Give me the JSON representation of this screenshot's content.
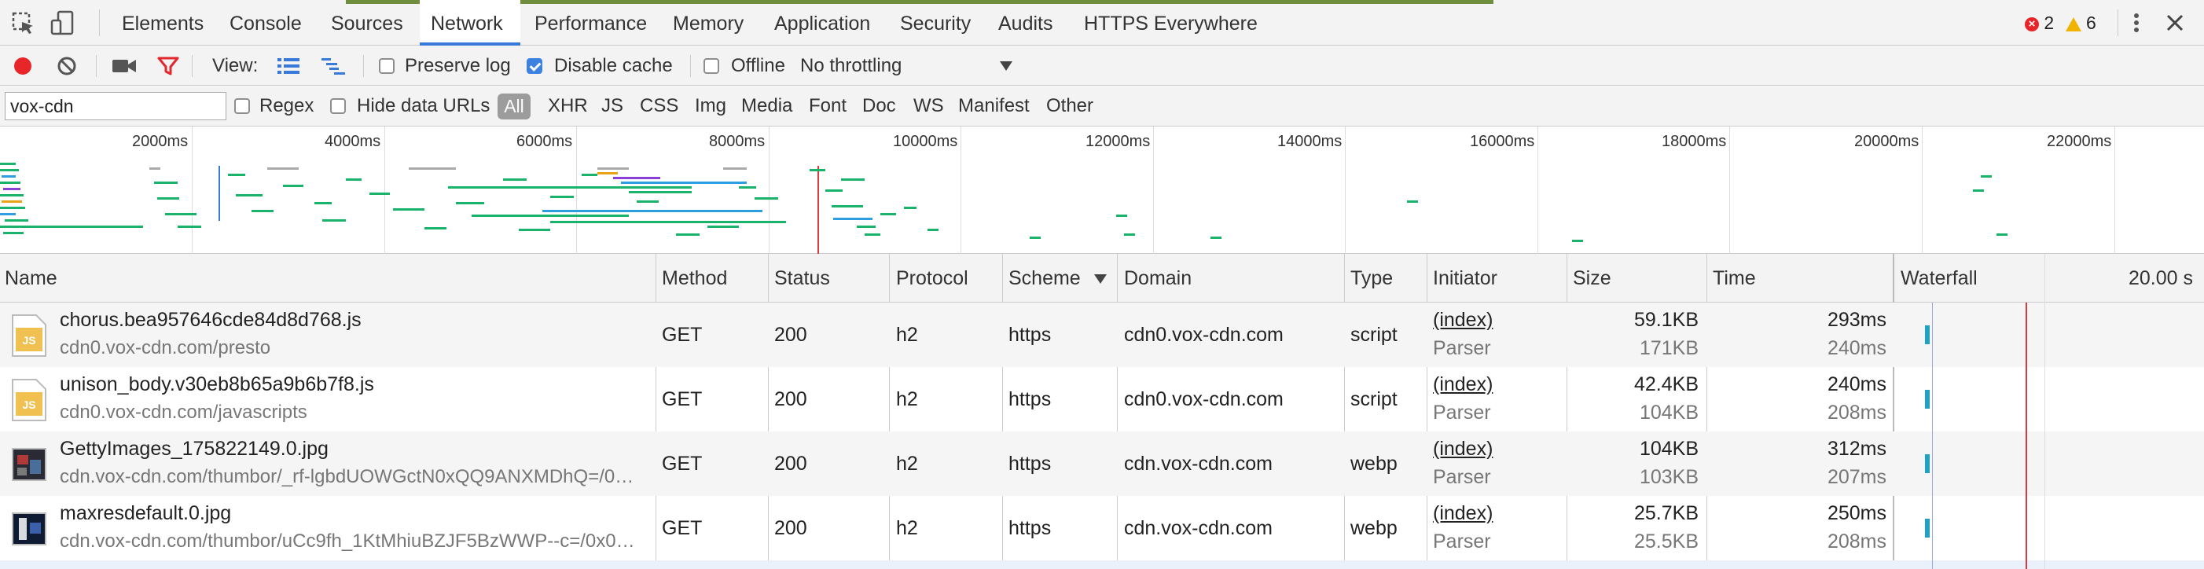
{
  "tabs": [
    {
      "label": "Elements",
      "active": false
    },
    {
      "label": "Console",
      "active": false
    },
    {
      "label": "Sources",
      "active": false
    },
    {
      "label": "Network",
      "active": true
    },
    {
      "label": "Performance",
      "active": false
    },
    {
      "label": "Memory",
      "active": false
    },
    {
      "label": "Application",
      "active": false
    },
    {
      "label": "Security",
      "active": false
    },
    {
      "label": "Audits",
      "active": false
    },
    {
      "label": "HTTPS Everywhere",
      "active": false
    }
  ],
  "status": {
    "errors": "2",
    "warnings": "6"
  },
  "toolbar": {
    "view_label": "View:",
    "preserve_log": {
      "label": "Preserve log",
      "checked": false
    },
    "disable_cache": {
      "label": "Disable cache",
      "checked": true
    },
    "offline": {
      "label": "Offline",
      "checked": false
    },
    "throttling": "No throttling"
  },
  "filter": {
    "value": "vox-cdn",
    "regex_label": "Regex",
    "hide_data_urls_label": "Hide data URLs",
    "types": [
      "All",
      "XHR",
      "JS",
      "CSS",
      "Img",
      "Media",
      "Font",
      "Doc",
      "WS",
      "Manifest",
      "Other"
    ]
  },
  "overview": {
    "ticks": [
      "2000ms",
      "4000ms",
      "6000ms",
      "8000ms",
      "10000ms",
      "12000ms",
      "14000ms",
      "16000ms",
      "18000ms",
      "20000ms",
      "22000ms"
    ]
  },
  "table": {
    "columns": [
      "Name",
      "Method",
      "Status",
      "Protocol",
      "Scheme",
      "Domain",
      "Type",
      "Initiator",
      "Size",
      "Time",
      "Waterfall"
    ],
    "waterfall_time": "20.00 s",
    "rows": [
      {
        "name": "chorus.bea957646cde84d8d768.js",
        "path": "cdn0.vox-cdn.com/presto",
        "method": "GET",
        "status": "200",
        "protocol": "h2",
        "scheme": "https",
        "domain": "cdn0.vox-cdn.com",
        "type": "script",
        "initiator": "(index)",
        "initiator_sub": "Parser",
        "size": "59.1KB",
        "size_sub": "171KB",
        "time": "293ms",
        "time_sub": "240ms",
        "icon": "js-file-icon"
      },
      {
        "name": "unison_body.v30eb8b65a9b6b7f8.js",
        "path": "cdn0.vox-cdn.com/javascripts",
        "method": "GET",
        "status": "200",
        "protocol": "h2",
        "scheme": "https",
        "domain": "cdn0.vox-cdn.com",
        "type": "script",
        "initiator": "(index)",
        "initiator_sub": "Parser",
        "size": "42.4KB",
        "size_sub": "104KB",
        "time": "240ms",
        "time_sub": "208ms",
        "icon": "js-file-icon"
      },
      {
        "name": "GettyImages_175822149.0.jpg",
        "path": "cdn.vox-cdn.com/thumbor/_rf-lgbdUOWGctN0xQQ9ANXMDhQ=/0…",
        "method": "GET",
        "status": "200",
        "protocol": "h2",
        "scheme": "https",
        "domain": "cdn.vox-cdn.com",
        "type": "webp",
        "initiator": "(index)",
        "initiator_sub": "Parser",
        "size": "104KB",
        "size_sub": "103KB",
        "time": "312ms",
        "time_sub": "207ms",
        "icon": "image-thumbnail-icon"
      },
      {
        "name": "maxresdefault.0.jpg",
        "path": "cdn.vox-cdn.com/thumbor/uCc9fh_1KtMhiuBZJF5BzWWP--c=/0x0…",
        "method": "GET",
        "status": "200",
        "protocol": "h2",
        "scheme": "https",
        "domain": "cdn.vox-cdn.com",
        "type": "webp",
        "initiator": "(index)",
        "initiator_sub": "Parser",
        "size": "25.7KB",
        "size_sub": "25.5KB",
        "time": "250ms",
        "time_sub": "208ms",
        "icon": "image-thumbnail-icon"
      }
    ]
  },
  "colors": {
    "accent": "#3879d9",
    "record": "#e8262a",
    "filter_icon": "#e0282e",
    "waterfall_bar": "#1ea1c7",
    "load_line": "#d83b3b"
  }
}
